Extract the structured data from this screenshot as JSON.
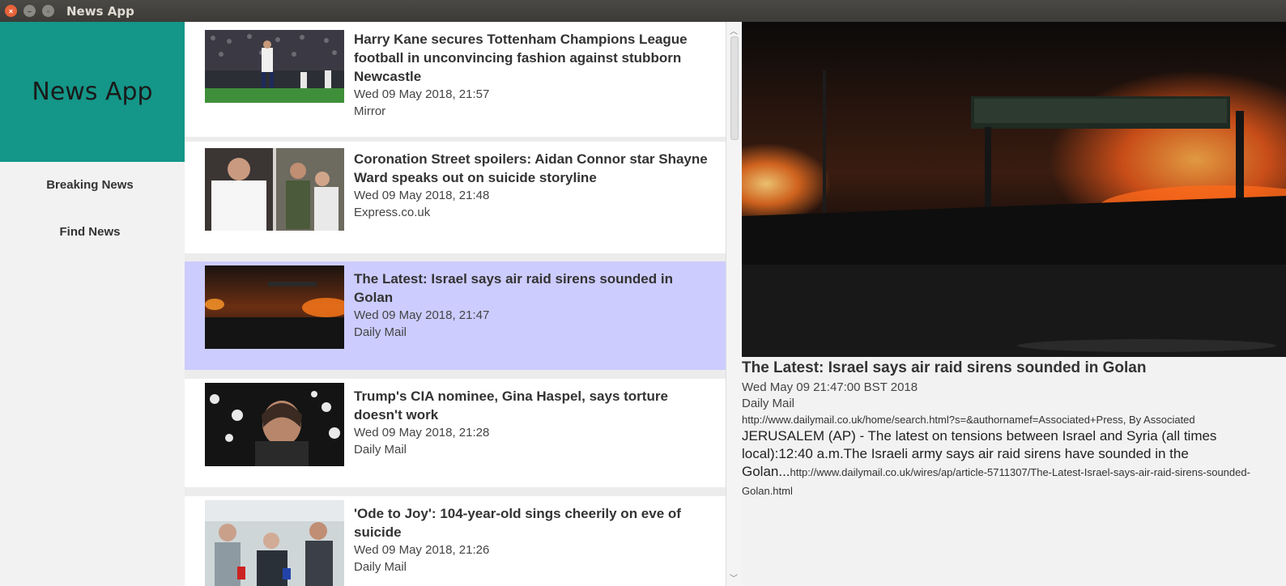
{
  "window": {
    "title": "News App"
  },
  "sidebar": {
    "title": "News App",
    "items": [
      {
        "label": "Breaking News"
      },
      {
        "label": "Find News"
      }
    ],
    "accent": "#149688"
  },
  "articles": [
    {
      "title_line1": "Harry Kane secures Tottenham Champions League",
      "title_line2": "football in unconvincing fashion against stubborn",
      "title_line3": "Newcastle",
      "date": "Wed 09 May 2018, 21:57",
      "source": "Mirror"
    },
    {
      "title_line1": "Coronation Street spoilers: Aidan Connor star Shayne",
      "title_line2": "Ward speaks out on suicide storyline",
      "title_line3": "",
      "date": "Wed 09 May 2018, 21:48",
      "source": "Express.co.uk"
    },
    {
      "title_line1": "The Latest: Israel says air raid sirens sounded in",
      "title_line2": "Golan",
      "title_line3": "",
      "date": "Wed 09 May 2018, 21:47",
      "source": "Daily Mail"
    },
    {
      "title_line1": "Trump's CIA nominee, Gina Haspel, says torture",
      "title_line2": "doesn't work",
      "title_line3": "",
      "date": "Wed 09 May 2018, 21:28",
      "source": "Daily Mail"
    },
    {
      "title_line1": "'Ode to Joy': 104-year-old sings cheerily on eve of",
      "title_line2": "suicide",
      "title_line3": "",
      "date": "Wed 09 May 2018, 21:26",
      "source": "Daily Mail"
    }
  ],
  "selected_color": "#ccccff",
  "detail": {
    "title": "The Latest: Israel says air raid sirens sounded in Golan",
    "date": "Wed May 09 21:47:00 BST 2018",
    "source": "Daily Mail",
    "author": "http://www.dailymail.co.uk/home/search.html?s=&authornamef=Associated+Press, By Associated",
    "body": "JERUSALEM (AP) - The latest on tensions between Israel and Syria (all times local):12:40 a.m.The Israeli army says air raid sirens have sounded in the Golan...",
    "link": "http://www.dailymail.co.uk/wires/ap/article-5711307/The-Latest-Israel-says-air-raid-sirens-sounded-Golan.html"
  }
}
